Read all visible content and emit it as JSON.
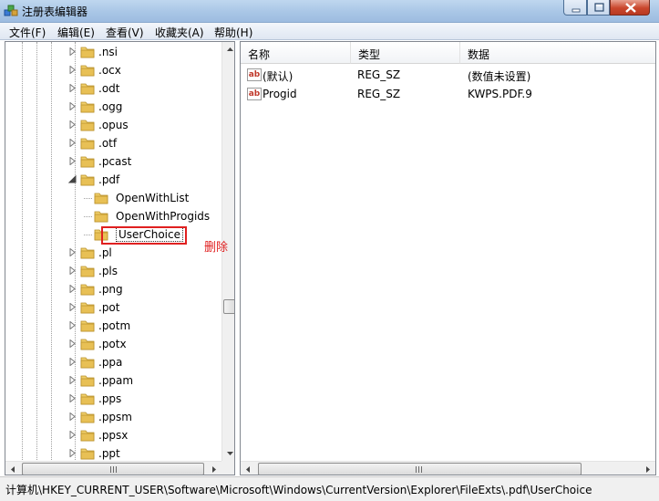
{
  "window": {
    "title": "注册表编辑器"
  },
  "menu": [
    "文件(F)",
    "编辑(E)",
    "查看(V)",
    "收藏夹(A)",
    "帮助(H)"
  ],
  "tree": {
    "items": [
      {
        "label": ".nsi",
        "expander": "collapsed"
      },
      {
        "label": ".ocx",
        "expander": "collapsed"
      },
      {
        "label": ".odt",
        "expander": "collapsed"
      },
      {
        "label": ".ogg",
        "expander": "collapsed"
      },
      {
        "label": ".opus",
        "expander": "collapsed"
      },
      {
        "label": ".otf",
        "expander": "collapsed"
      },
      {
        "label": ".pcast",
        "expander": "collapsed"
      },
      {
        "label": ".pdf",
        "expander": "expanded"
      },
      {
        "label": "OpenWithList",
        "expander": "none",
        "child": true
      },
      {
        "label": "OpenWithProgids",
        "expander": "none",
        "child": true
      },
      {
        "label": "UserChoice",
        "expander": "none",
        "child": true,
        "selected": true
      },
      {
        "label": ".pl",
        "expander": "collapsed"
      },
      {
        "label": ".pls",
        "expander": "collapsed"
      },
      {
        "label": ".png",
        "expander": "collapsed"
      },
      {
        "label": ".pot",
        "expander": "collapsed"
      },
      {
        "label": ".potm",
        "expander": "collapsed"
      },
      {
        "label": ".potx",
        "expander": "collapsed"
      },
      {
        "label": ".ppa",
        "expander": "collapsed"
      },
      {
        "label": ".ppam",
        "expander": "collapsed"
      },
      {
        "label": ".pps",
        "expander": "collapsed"
      },
      {
        "label": ".ppsm",
        "expander": "collapsed"
      },
      {
        "label": ".ppsx",
        "expander": "collapsed"
      },
      {
        "label": ".ppt",
        "expander": "collapsed"
      }
    ]
  },
  "annotation": "删除",
  "list": {
    "columns": [
      "名称",
      "类型",
      "数据"
    ],
    "rows": [
      {
        "name": "(默认)",
        "type": "REG_SZ",
        "data": "(数值未设置)",
        "icon": "string-value-icon"
      },
      {
        "name": "Progid",
        "type": "REG_SZ",
        "data": "KWPS.PDF.9",
        "icon": "string-value-icon"
      }
    ]
  },
  "status": {
    "path": "计算机\\HKEY_CURRENT_USER\\Software\\Microsoft\\Windows\\CurrentVersion\\Explorer\\FileExts\\.pdf\\UserChoice"
  },
  "colors": {
    "highlight_box": "#e02020",
    "folder": "#e8c055",
    "titlebar": "#a9c6e6"
  }
}
